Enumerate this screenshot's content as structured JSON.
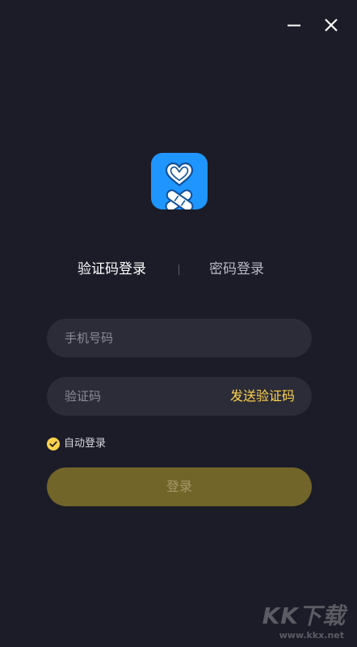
{
  "window": {
    "minimize_icon": "minimize-icon",
    "close_icon": "close-icon"
  },
  "app": {
    "logo_icon": "heart-bandage-icon",
    "accent": "#1f96ff"
  },
  "tabs": {
    "sms_label": "验证码登录",
    "password_label": "密码登录",
    "active": "sms"
  },
  "form": {
    "phone": {
      "value": "",
      "placeholder": "手机号码"
    },
    "code": {
      "value": "",
      "placeholder": "验证码"
    },
    "send_code_label": "发送验证码",
    "auto_login": {
      "checked": true,
      "label": "自动登录"
    },
    "submit_label": "登录"
  },
  "colors": {
    "background": "#1b1c27",
    "input_background": "#2b2c38",
    "accent_yellow": "#ffd24a",
    "button_disabled": "#726529"
  },
  "watermark": {
    "logo_text": "KK下载",
    "url": "www.kkx.net"
  }
}
